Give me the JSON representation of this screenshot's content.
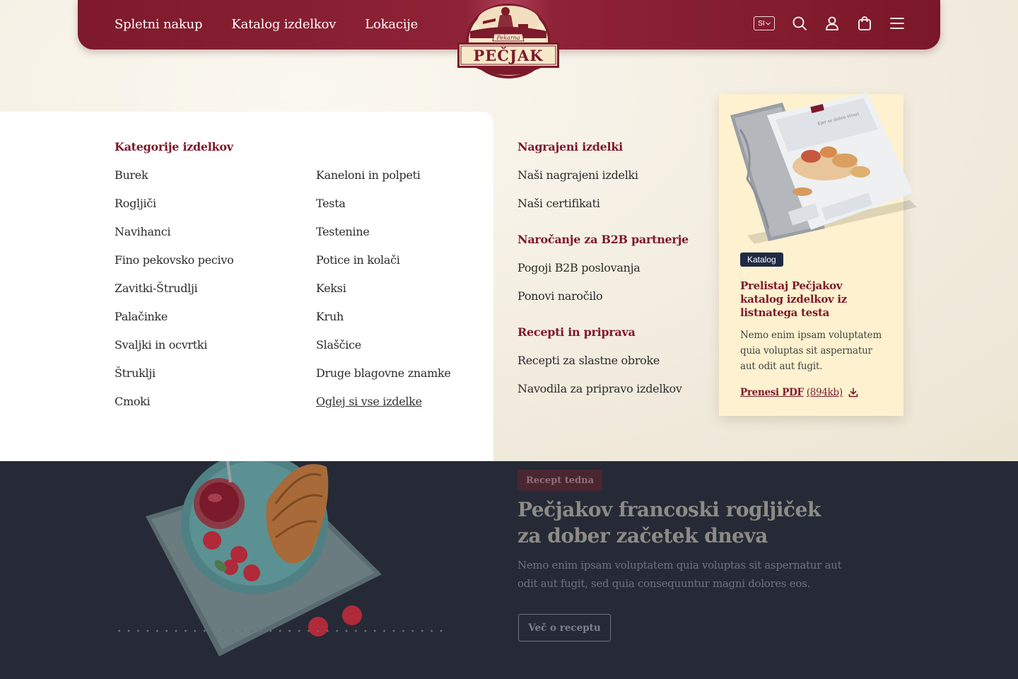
{
  "header": {
    "nav": [
      "Spletni nakup",
      "Katalog izdelkov",
      "Lokacije"
    ],
    "lang": "SI",
    "logo": {
      "script": "Pekarna",
      "brand": "PEČJAK"
    }
  },
  "products": {
    "heading": "Kategorije izdelkov",
    "col1": [
      "Burek",
      "Rogljiči",
      "Navihanci",
      "Fino pekovsko pecivo",
      "Zavitki-Štrudlji",
      "Palačinke",
      "Svaljki in ocvrtki",
      "Štruklji",
      "Cmoki"
    ],
    "col2": [
      "Kaneloni in polpeti",
      "Testa",
      "Testenine",
      "Potice in kolači",
      "Keksi",
      "Kruh",
      "Slaščice",
      "Druge blagovne znamke"
    ],
    "view_all": "Oglej si vse izdelke"
  },
  "awards": {
    "heading": "Nagrajeni izdelki",
    "items": [
      "Naši nagrajeni izdelki",
      "Naši certifikati"
    ]
  },
  "b2b": {
    "heading": "Naročanje za B2B partnerje",
    "items": [
      "Pogoji B2B poslovanja",
      "Ponovi naročilo"
    ]
  },
  "recipes": {
    "heading": "Recepti in priprava",
    "items": [
      "Recepti za slastne obroke",
      "Navodila za pripravo izdelkov"
    ]
  },
  "catalog": {
    "badge": "Katalog",
    "title": "Prelistaj Pečjakov katalog izdelkov iz listnatega testa",
    "desc": "Nemo enim ipsam voluptatem quia voluptas sit aspernatur aut odit aut fugit.",
    "link_label": "Prenesi PDF",
    "link_size": "(894kb)"
  },
  "recipe_week": {
    "badge": "Recept tedna",
    "title": "Pečjakov francoski rogljiček za dober začetek dneva",
    "desc": "Nemo enim ipsam voluptatem quia voluptas sit aspernatur aut odit aut fugit, sed quia consequuntur magni dolores eos.",
    "button": "Več o receptu"
  },
  "colors": {
    "brand": "#7d1a2b",
    "dark_navy": "#1f2a44",
    "bottom_bg": "#252a36",
    "catalog_bg": "#fdf1cf"
  },
  "icons": [
    "search-icon",
    "user-icon",
    "cart-icon",
    "menu-icon",
    "download-icon",
    "chevron-down-icon"
  ]
}
